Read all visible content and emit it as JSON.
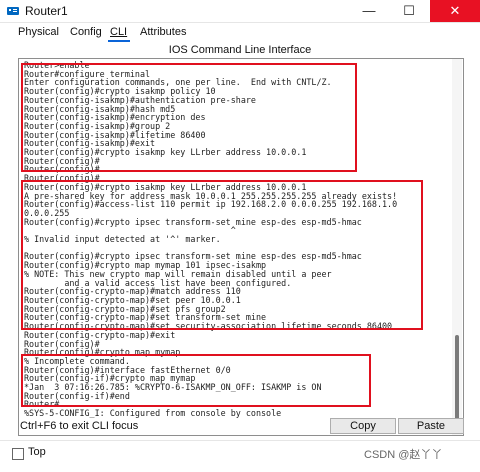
{
  "window": {
    "title": "Router1"
  },
  "tabs": {
    "physical": "Physical",
    "config": "Config",
    "cli": "CLI",
    "attributes": "Attributes"
  },
  "section_title": "IOS Command Line Interface",
  "cli_text": "Router>enable\nRouter#configure terminal\nEnter configuration commands, one per line.  End with CNTL/Z.\nRouter(config)#crypto isakmp policy 10\nRouter(config-isakmp)#authentication pre-share\nRouter(config-isakmp)#hash md5\nRouter(config-isakmp)#encryption des\nRouter(config-isakmp)#group 2\nRouter(config-isakmp)#lifetime 86400\nRouter(config-isakmp)#exit\nRouter(config)#crypto isakmp key LLrber address 10.0.0.1\nRouter(config)#\nRouter(config)#\nRouter(config)#\nRouter(config)#crypto isakmp key LLrber address 10.0.0.1\nA pre-shared key for address mask 10.0.0.1 255.255.255.255 already exists!\nRouter(config)#access-list 110 permit ip 192.168.2.0 0.0.0.255 192.168.1.0\n0.0.0.255\nRouter(config)#crypto ipsec transform-set mine esp-des esp-md5-hmac\n                                         ^\n% Invalid input detected at '^' marker.\n\nRouter(config)#crypto ipsec transform-set mine esp-des esp-md5-hmac\nRouter(config)#crypto map mymap 101 ipsec-isakmp\n% NOTE: This new crypto map will remain disabled until a peer\n        and a valid access list have been configured.\nRouter(config-crypto-map)#match address 110\nRouter(config-crypto-map)#set peer 10.0.0.1\nRouter(config-crypto-map)#set pfs group2\nRouter(config-crypto-map)#set transform-set mine\nRouter(config-crypto-map)#set security-association lifetime seconds 86400\nRouter(config-crypto-map)#exit\nRouter(config)#\nRouter(config)#crypto map mymap\n% Incomplete command.\nRouter(config)#interface fastEthernet 0/0\nRouter(config-if)#crypto map mymap\n*Jan  3 07:16:26.785: %CRYPTO-6-ISAKMP_ON_OFF: ISAKMP is ON\nRouter(config-if)#end\nRouter#\n%SYS-5-CONFIG_I: Configured from console by console",
  "footer": {
    "hint": "Ctrl+F6 to exit CLI focus",
    "copy": "Copy",
    "paste": "Paste",
    "top": "Top",
    "watermark": "CSDN @赵丫丫"
  },
  "accent": "#0a64d8",
  "highlight": "#e0101e"
}
